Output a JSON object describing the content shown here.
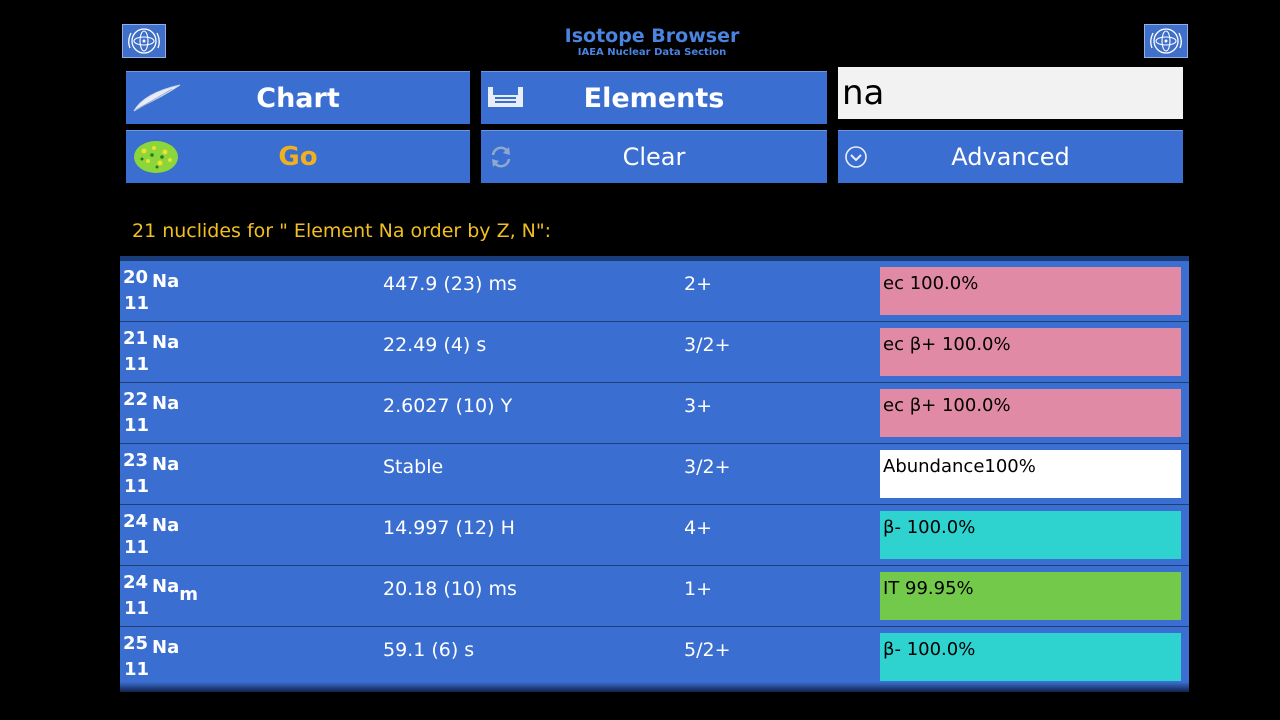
{
  "header": {
    "title": "Isotope Browser",
    "subtitle": "IAEA Nuclear Data Section"
  },
  "buttons": {
    "chart": "Chart",
    "elements": "Elements",
    "go": "Go",
    "clear": "Clear",
    "advanced": "Advanced"
  },
  "search": {
    "value": "na"
  },
  "result_summary": "21 nuclides for \" Element Na  order by  Z, N\":",
  "rows": [
    {
      "a": "20",
      "symbol": "Na",
      "meta": "",
      "z": "11",
      "half_life": "447.9 (23) ms",
      "spin": "2+",
      "decay": "ec 100.0%",
      "decay_color": "#e08aa6"
    },
    {
      "a": "21",
      "symbol": "Na",
      "meta": "",
      "z": "11",
      "half_life": "22.49 (4) s",
      "spin": "3/2+",
      "decay": "ec β+ 100.0%",
      "decay_color": "#e08aa6"
    },
    {
      "a": "22",
      "symbol": "Na",
      "meta": "",
      "z": "11",
      "half_life": "2.6027 (10) Y",
      "spin": "3+",
      "decay": "ec β+ 100.0%",
      "decay_color": "#e08aa6"
    },
    {
      "a": "23",
      "symbol": "Na",
      "meta": "",
      "z": "11",
      "half_life": "Stable",
      "spin": "3/2+",
      "decay": "Abundance100%",
      "decay_color": "#ffffff"
    },
    {
      "a": "24",
      "symbol": "Na",
      "meta": "",
      "z": "11",
      "half_life": "14.997 (12) H",
      "spin": "4+",
      "decay": "β- 100.0%",
      "decay_color": "#2ed3d0"
    },
    {
      "a": "24",
      "symbol": "Na",
      "meta": "m",
      "z": "11",
      "half_life": "20.18 (10) ms",
      "spin": "1+",
      "decay": "IT 99.95%",
      "decay_color": "#72c94a"
    },
    {
      "a": "25",
      "symbol": "Na",
      "meta": "",
      "z": "11",
      "half_life": "59.1 (6) s",
      "spin": "5/2+",
      "decay": "β- 100.0%",
      "decay_color": "#2ed3d0"
    }
  ],
  "colors": {
    "button_bg": "#3a6ed0",
    "go_text": "#f0b020",
    "summary_text": "#f0c020",
    "title_text": "#4a84e0"
  },
  "icons": {
    "logo": "iaea-logo-icon",
    "chart": "feather-icon",
    "elements": "periodic-table-icon",
    "go": "green-blob-icon",
    "clear": "refresh-icon",
    "advanced": "chevron-down-circle-icon"
  }
}
